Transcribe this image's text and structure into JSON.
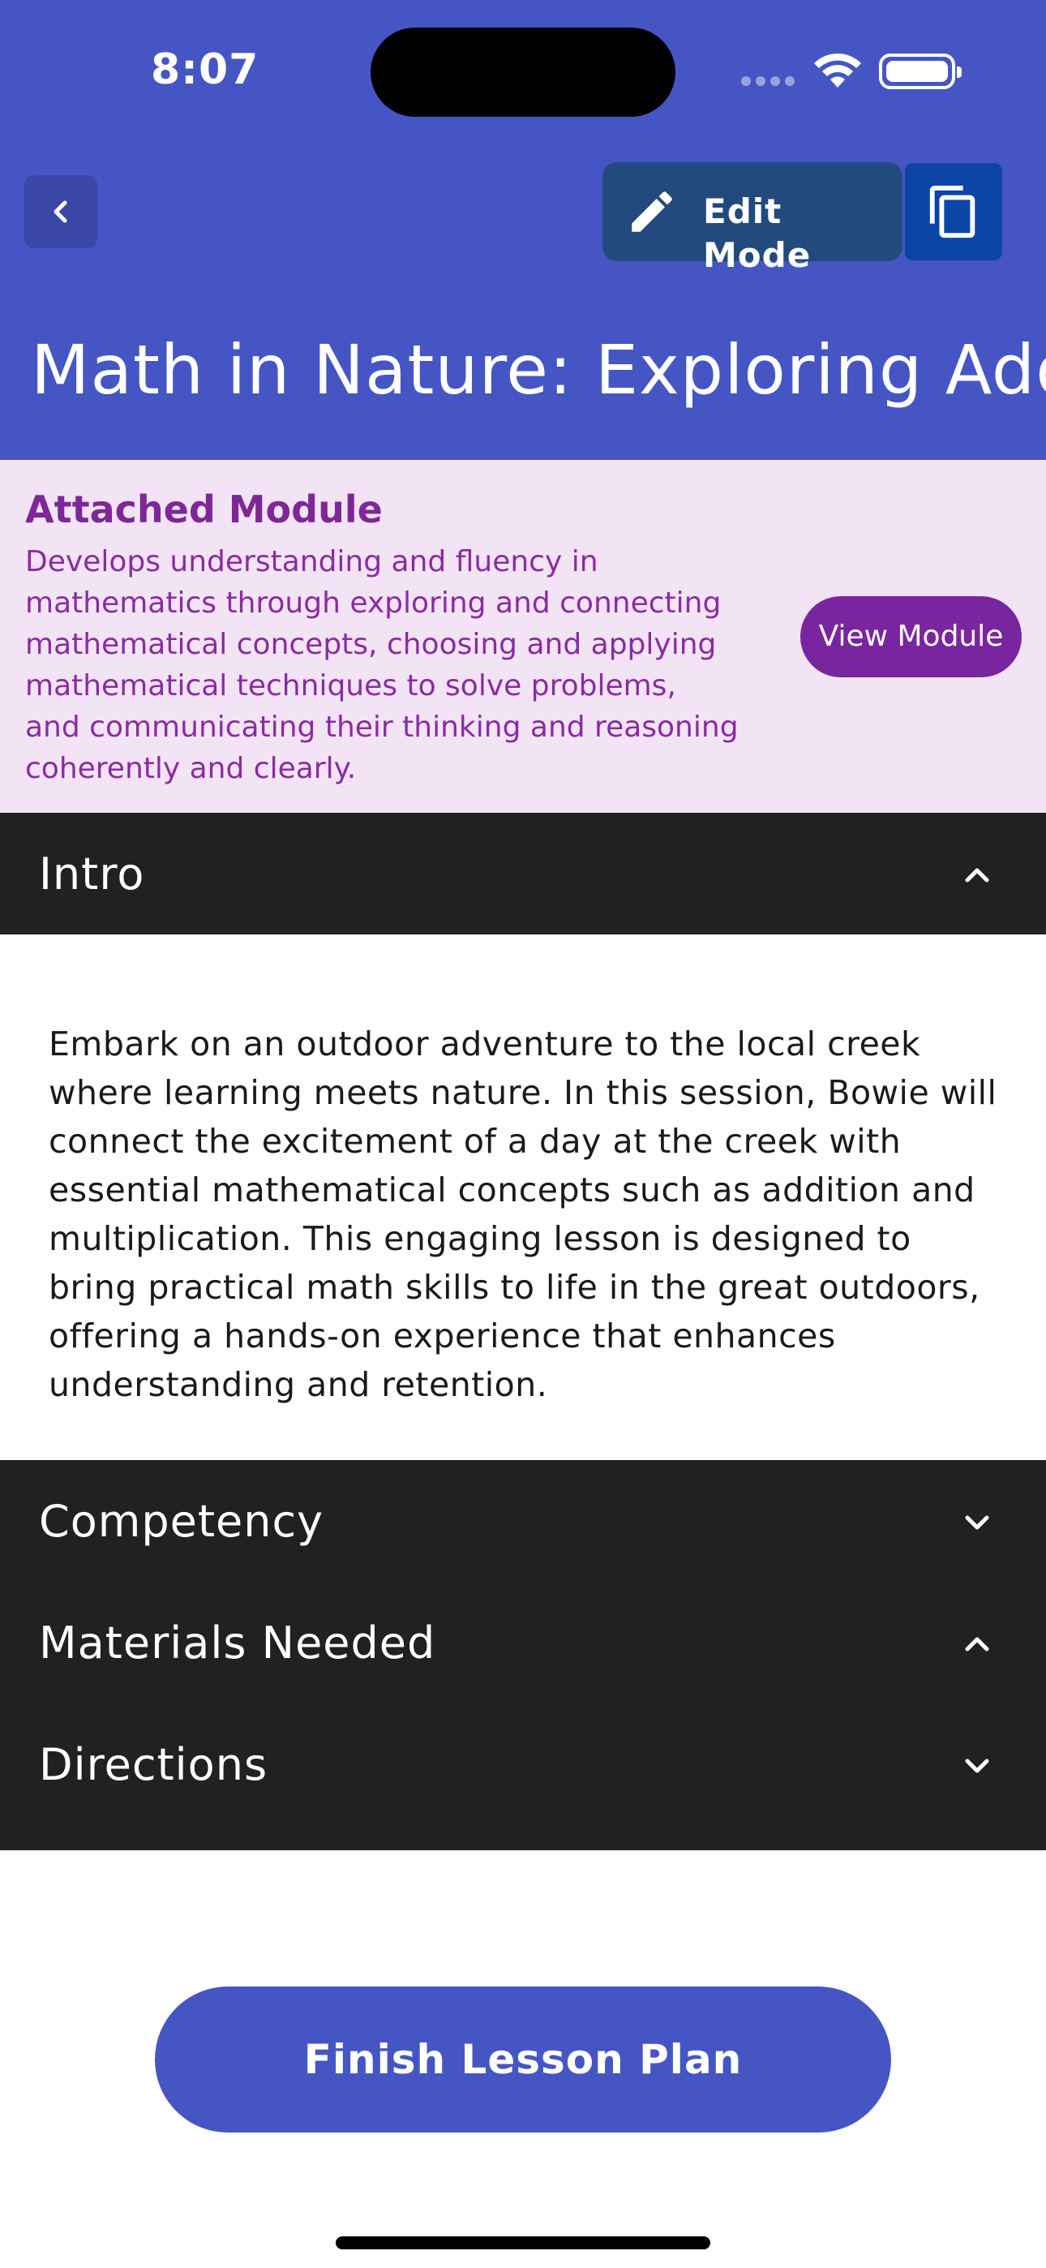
{
  "status_bar": {
    "time": "8:07"
  },
  "header": {
    "edit_label": "Edit Mode",
    "title": "Math in Nature: Exploring Addition and Multiplication at the Creek"
  },
  "module": {
    "title": "Attached Module",
    "description": "Develops understanding and fluency in mathematics through exploring and connecting mathematical concepts, choosing and applying mathematical techniques to solve problems, and communicating their thinking and reasoning coherently and clearly.",
    "view_label": "View Module"
  },
  "sections": {
    "intro": {
      "label": "Intro",
      "chevron": "chevron-up-icon"
    },
    "competency": {
      "label": "Competency",
      "chevron": "chevron-down-icon"
    },
    "materials": {
      "label": "Materials Needed",
      "chevron": "chevron-up-icon"
    },
    "directions": {
      "label": "Directions",
      "chevron": "chevron-down-icon"
    }
  },
  "intro_body": "Embark on an outdoor adventure to the local creek where learning meets nature. In this session, Bowie will connect the excitement of a day at the creek with essential mathematical concepts such as addition and multiplication. This engaging lesson is designed to bring practical math skills to life in the great outdoors, offering a hands-on experience that enhances understanding and retention.",
  "footer": {
    "finish_label": "Finish Lesson Plan"
  },
  "colors": {
    "header": "#4556C4",
    "module_bg": "#F3E4F5",
    "module_accent": "#7A25A0",
    "section_bg": "#212121"
  }
}
